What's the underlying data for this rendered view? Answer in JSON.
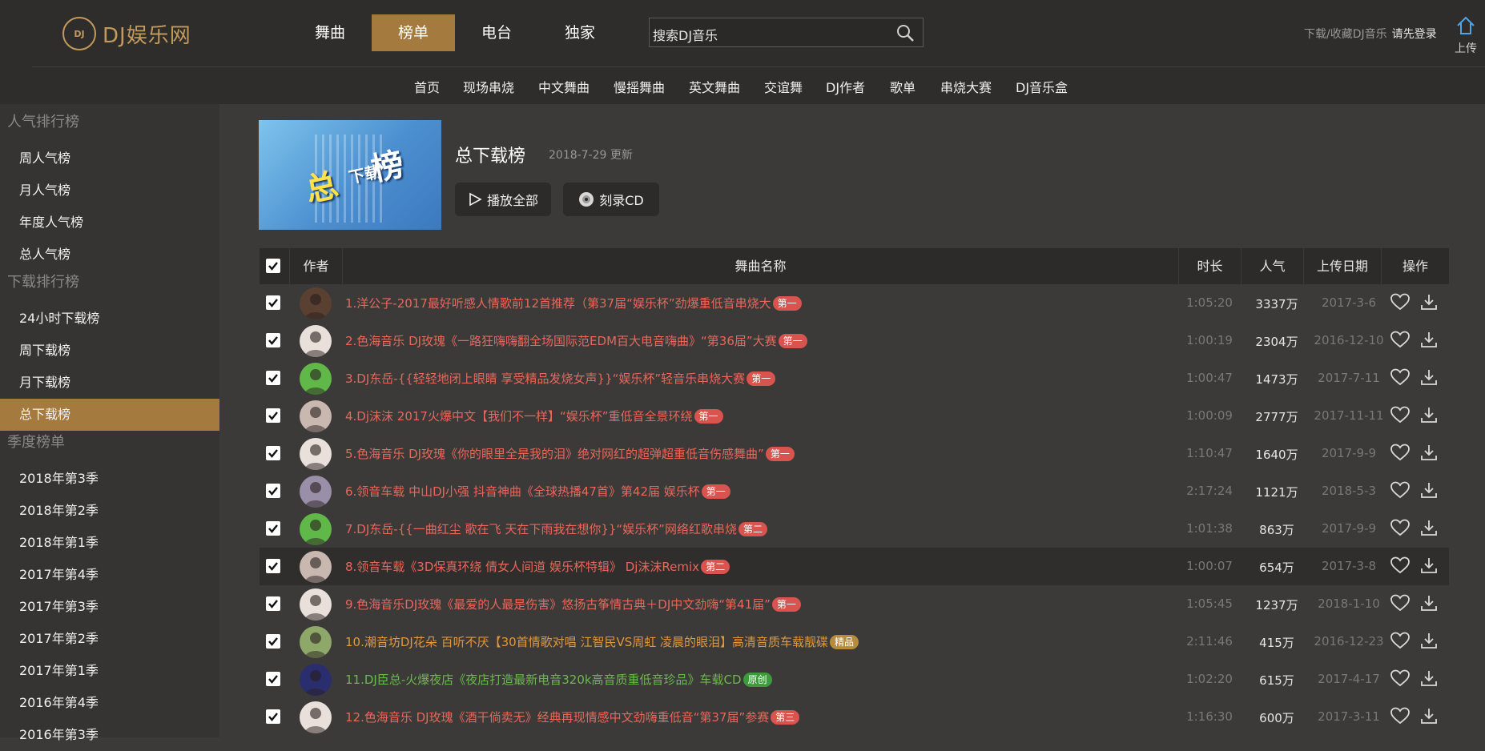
{
  "header": {
    "logo_badge": "DJ",
    "logo_text": "DJ娱乐网",
    "nav": [
      {
        "label": "舞曲",
        "active": false
      },
      {
        "label": "榜单",
        "active": true
      },
      {
        "label": "电台",
        "active": false
      },
      {
        "label": "独家",
        "active": false
      }
    ],
    "search_placeholder": "搜索DJ音乐",
    "login_hint": "下载/收藏DJ音乐",
    "login_link": "请先登录",
    "upload_label": "上传",
    "accent": "#a47a3f"
  },
  "subnav": [
    "首页",
    "现场串烧",
    "中文舞曲",
    "慢摇舞曲",
    "英文舞曲",
    "交谊舞",
    "DJ作者",
    "歌单",
    "串烧大赛",
    "DJ音乐盒"
  ],
  "sidebar": {
    "groups": [
      {
        "title": "人气排行榜",
        "items": [
          "周人气榜",
          "月人气榜",
          "年度人气榜",
          "总人气榜"
        ]
      },
      {
        "title": "下载排行榜",
        "items": [
          "24小时下载榜",
          "周下载榜",
          "月下载榜",
          "总下载榜"
        ]
      },
      {
        "title": "季度榜单",
        "items": [
          "2018年第3季",
          "2018年第2季",
          "2018年第1季",
          "2017年第4季",
          "2017年第3季",
          "2017年第2季",
          "2017年第1季",
          "2016年第4季",
          "2016年第3季"
        ]
      }
    ],
    "active_item": "总下载榜"
  },
  "playlist": {
    "cover_text": [
      "总",
      "下载",
      "榜"
    ],
    "title": "总下载榜",
    "updated": "2018-7-29 更新",
    "play_all": "播放全部",
    "burn_cd": "刻录CD"
  },
  "table": {
    "headers": {
      "author": "作者",
      "name": "舞曲名称",
      "duration": "时长",
      "popularity": "人气",
      "upload_date": "上传日期",
      "actions": "操作"
    },
    "rows": [
      {
        "title": "1.洋公子-2017最好听感人情歌前12首推荐（第37届“娱乐杯”劲爆重低音串烧大",
        "badge": "第一",
        "badge_color": "red",
        "title_color": "red",
        "duration": "1:05:20",
        "popularity": "3337万",
        "date": "2017-3-6",
        "avatar": "#5a4030",
        "highlight": false
      },
      {
        "title": "2.色海音乐 DJ玫瑰《一路狂嗨嗨翻全场国际范EDM百大电音嗨曲》“第36届”大赛",
        "badge": "第一",
        "badge_color": "red",
        "title_color": "red",
        "duration": "1:00:19",
        "popularity": "2304万",
        "date": "2016-12-10",
        "avatar": "#e9e0dc",
        "highlight": false
      },
      {
        "title": "3.DJ东岳-{{轻轻地闭上眼睛 享受精品发烧女声}}“娱乐杯”轻音乐串烧大赛",
        "badge": "第一",
        "badge_color": "red",
        "title_color": "red",
        "duration": "1:00:47",
        "popularity": "1473万",
        "date": "2017-7-11",
        "avatar": "#5fb848",
        "highlight": false
      },
      {
        "title": "4.Dj沫沫 2017火爆中文【我们不一样】“娱乐杯”重低音全景环绕",
        "badge": "第一",
        "badge_color": "red",
        "title_color": "red",
        "duration": "1:00:09",
        "popularity": "2777万",
        "date": "2017-11-11",
        "avatar": "#c9b8b0",
        "highlight": false
      },
      {
        "title": "5.色海音乐 DJ玫瑰《你的眼里全是我的泪》绝对网红的超弹超重低音伤感舞曲”",
        "badge": "第一",
        "badge_color": "red",
        "title_color": "red",
        "duration": "1:10:47",
        "popularity": "1640万",
        "date": "2017-9-9",
        "avatar": "#e9e0dc",
        "highlight": false
      },
      {
        "title": "6.领音车载 中山DJ小强 抖音神曲《全球热播47首》第42届 娱乐杯",
        "badge": "第一",
        "badge_color": "red",
        "title_color": "red",
        "duration": "2:17:24",
        "popularity": "1121万",
        "date": "2018-5-3",
        "avatar": "#9a8fa8",
        "highlight": false
      },
      {
        "title": "7.DJ东岳-{{一曲红尘 歌在飞 天在下雨我在想你}}“娱乐杯”网络红歌串烧",
        "badge": "第二",
        "badge_color": "red",
        "title_color": "red",
        "duration": "1:01:38",
        "popularity": "863万",
        "date": "2017-9-9",
        "avatar": "#5fb848",
        "highlight": false
      },
      {
        "title": "8.领音车载《3D保真环绕 倩女人间道 娱乐杯特辑》 Dj沫沫Remix",
        "badge": "第二",
        "badge_color": "red",
        "title_color": "red",
        "duration": "1:00:07",
        "popularity": "654万",
        "date": "2017-3-8",
        "avatar": "#c9b8b0",
        "highlight": true
      },
      {
        "title": "9.色海音乐DJ玫瑰《最爱的人最是伤害》悠扬古筝情古典＋DJ中文劲嗨“第41届”",
        "badge": "第一",
        "badge_color": "red",
        "title_color": "red",
        "duration": "1:05:45",
        "popularity": "1237万",
        "date": "2018-1-10",
        "avatar": "#e9e0dc",
        "highlight": false
      },
      {
        "title": "10.潮音坊DJ花朵 百听不厌【30首情歌对唱 江智民VS周虹 凌晨的眼泪】高清音质车载靓碟",
        "badge": "精品",
        "badge_color": "gold",
        "title_color": "orange",
        "duration": "2:11:46",
        "popularity": "415万",
        "date": "2016-12-23",
        "avatar": "#8ea86a",
        "highlight": false
      },
      {
        "title": "11.DJ臣总-火爆夜店《夜店打造最新电音320k高音质重低音珍品》车载CD",
        "badge": "原创",
        "badge_color": "green",
        "title_color": "green",
        "duration": "1:02:20",
        "popularity": "615万",
        "date": "2017-4-17",
        "avatar": "#2a2e6e",
        "highlight": false
      },
      {
        "title": "12.色海音乐 DJ玫瑰《酒干倘卖无》经典再现情感中文劲嗨重低音“第37届”参赛",
        "badge": "第三",
        "badge_color": "red",
        "title_color": "red",
        "duration": "1:16:30",
        "popularity": "600万",
        "date": "2017-3-11",
        "avatar": "#e9e0dc",
        "highlight": false
      }
    ]
  }
}
